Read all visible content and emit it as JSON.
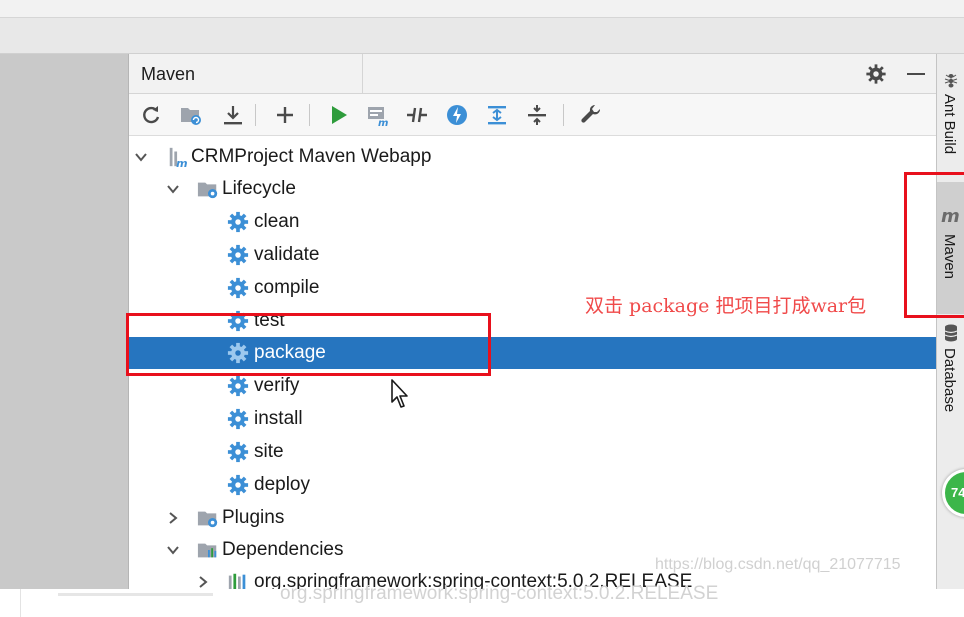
{
  "window": {
    "title": "Maven"
  },
  "toolbar": {
    "items": [
      "refresh-icon",
      "reimport-folder-icon",
      "download-sources-icon",
      "add-icon",
      "run-icon",
      "execute-goal-icon",
      "toggle-offline-icon",
      "skip-tests-icon",
      "show-dependencies-icon",
      "collapse-all-icon",
      "settings-wrench-icon"
    ]
  },
  "tree": {
    "project": "CRMProject Maven Webapp",
    "lifecycle": "Lifecycle",
    "goals": [
      "clean",
      "validate",
      "compile",
      "test",
      "package",
      "verify",
      "install",
      "site",
      "deploy"
    ],
    "selected_goal": "package",
    "plugins": "Plugins",
    "dependencies": "Dependencies",
    "dependency_item": "org.springframework:spring-context:5.0.2.RELEASE"
  },
  "side_strip": {
    "tabs": [
      "Ant Build",
      "Maven",
      "Database"
    ],
    "active": "Maven",
    "badge": "74"
  },
  "annotation": {
    "note": "双击 package 把项目打成war包"
  },
  "watermark": "https://blog.csdn.net/qq_21077715",
  "ghost": {
    "text": "org.springframework:spring-context:5.0.2.RELEASE"
  },
  "colors": {
    "selection": "#2675bf",
    "annotation_red": "#e8101c",
    "note_red": "#f04a4a",
    "gear_blue": "#3c8fd6",
    "run_green": "#2e9c3c"
  }
}
